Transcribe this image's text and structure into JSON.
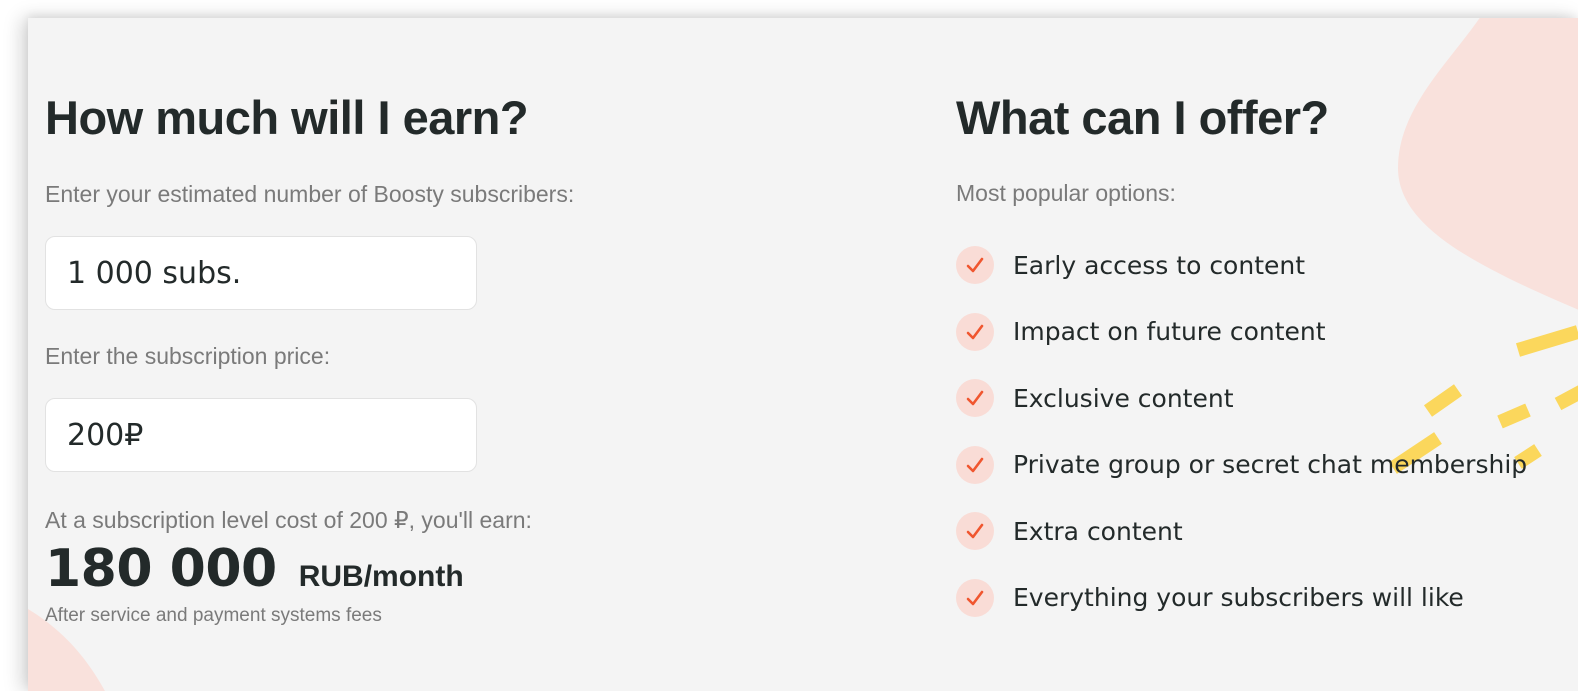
{
  "earn": {
    "title": "How much will I earn?",
    "subscribers_label": "Enter your estimated number of Boosty subscribers:",
    "subscribers_value": "1 000 subs.",
    "price_label": "Enter the subscription price:",
    "price_value": "200₽",
    "result_label": "At a subscription level cost of 200 ₽, you'll earn:",
    "result_amount": "180 000",
    "result_unit": "RUB/month",
    "fee_note": "After service and payment systems fees"
  },
  "offer": {
    "title": "What can I offer?",
    "subtitle": "Most popular options:",
    "items": [
      {
        "label": "Early access to content",
        "icon": "check-icon"
      },
      {
        "label": "Impact on future content",
        "icon": "check-icon"
      },
      {
        "label": "Exclusive content",
        "icon": "check-icon"
      },
      {
        "label": "Private group or secret chat membership",
        "icon": "check-icon"
      },
      {
        "label": "Extra content",
        "icon": "check-icon"
      },
      {
        "label": "Everything your subscribers will like",
        "icon": "check-icon"
      }
    ]
  },
  "colors": {
    "background": "#f4f4f4",
    "heading": "#232a2a",
    "muted_text": "#7a7a7a",
    "check_accent": "#f0562f",
    "check_bg": "#f9dcd6",
    "blob_pink": "#f9e1dc",
    "dash_yellow": "#fbd75c"
  }
}
